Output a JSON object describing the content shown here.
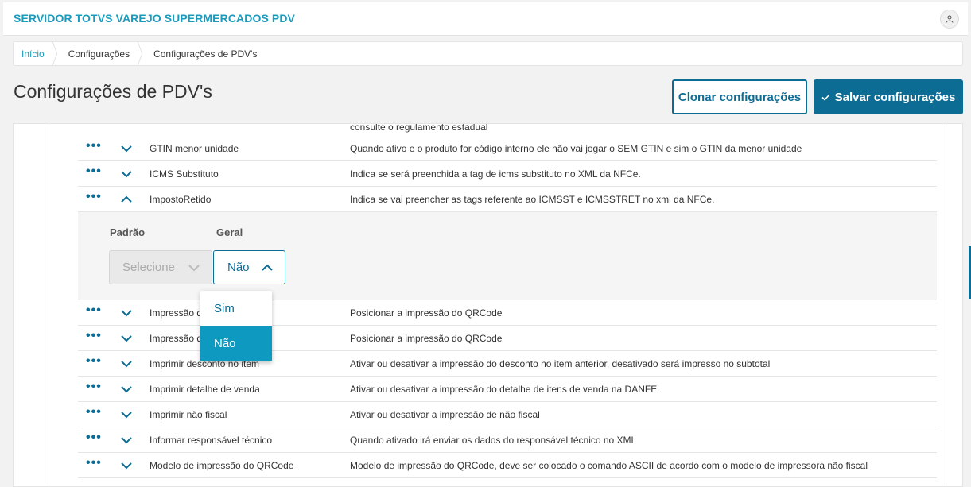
{
  "app": {
    "title": "SERVIDOR TOTVS VAREJO SUPERMERCADOS PDV"
  },
  "breadcrumb": [
    "Início",
    "Configurações",
    "Configurações de PDV's"
  ],
  "page": {
    "title": "Configurações de PDV's",
    "clone_label": "Clonar configurações",
    "save_label": "Salvar configurações"
  },
  "partial_row_text": "consulte o regulamento estadual",
  "rows_top": [
    {
      "name": "GTIN menor unidade",
      "desc": "Quando ativo e o produto for código interno ele não vai jogar o SEM GTIN e sim o GTIN da menor unidade"
    },
    {
      "name": "ICMS Substituto",
      "desc": "Indica se será preenchida a tag de icms substituto no XML da NFCe."
    },
    {
      "name": "ImpostoRetido",
      "desc": "Indica se vai preencher as tags referente ao ICMSST e ICMSSTRET no xml da NFCe."
    }
  ],
  "expanded": {
    "padrao_label": "Padrão",
    "geral_label": "Geral",
    "padrao_placeholder": "Selecione",
    "geral_value": "Não",
    "options": [
      "Sim",
      "Não"
    ]
  },
  "rows_bottom": [
    {
      "name": "Impressão do Q",
      "desc": "Posicionar a impressão do QRCode"
    },
    {
      "name": "Impressão do Q",
      "desc": "Posicionar a impressão do QRCode"
    },
    {
      "name": "Imprimir desconto no item",
      "desc": "Ativar ou desativar a impressão do desconto no item anterior, desativado será impresso no subtotal"
    },
    {
      "name": "Imprimir detalhe de venda",
      "desc": "Ativar ou desativar a impressão do detalhe de itens de venda na DANFE"
    },
    {
      "name": "Imprimir não fiscal",
      "desc": "Ativar ou desativar a impressão de não fiscal"
    },
    {
      "name": "Informar responsável técnico",
      "desc": "Quando ativado irá enviar os dados do responsável técnico no XML"
    },
    {
      "name": "Modelo de impressão do QRCode",
      "desc": "Modelo de impressão do QRCode, deve ser colocado o comando ASCII de acordo com o modelo de impressora não fiscal"
    }
  ],
  "colors": {
    "accent": "#0c6c94",
    "title": "#1a9bbd",
    "selected": "#0e9ac0"
  },
  "icons": {
    "row_menu": "more-dots-icon",
    "expand": "chevron-down-icon",
    "collapse": "chevron-up-icon",
    "check": "check-icon",
    "user": "user-icon"
  }
}
